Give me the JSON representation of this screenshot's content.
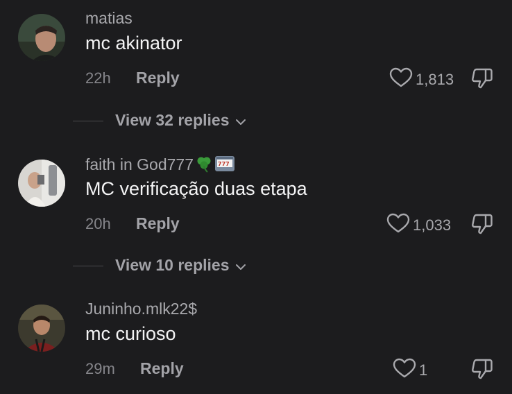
{
  "comments": [
    {
      "username": "matias",
      "text": "mc akinator",
      "time": "22h",
      "reply_label": "Reply",
      "likes": "1,813",
      "view_replies": "View 32 replies",
      "avatar_icon": "profile-photo"
    },
    {
      "username": "faith in God777",
      "username_emojis": [
        "shamrock-icon",
        "slot-machine-icon"
      ],
      "text": "MC verificação duas etapa",
      "time": "20h",
      "reply_label": "Reply",
      "likes": "1,033",
      "view_replies": "View 10 replies",
      "avatar_icon": "profile-photo"
    },
    {
      "username": "Juninho.mlk22$",
      "text": "mc curioso",
      "time": "29m",
      "reply_label": "Reply",
      "likes": "1",
      "avatar_icon": "profile-photo"
    }
  ],
  "icons": {
    "like": "heart-outline-icon",
    "dislike": "thumbs-down-icon",
    "expand": "chevron-down-icon"
  },
  "colors": {
    "background": "#1c1c1e",
    "text_primary": "#f4f4f5",
    "text_secondary": "#a9a9ad"
  }
}
